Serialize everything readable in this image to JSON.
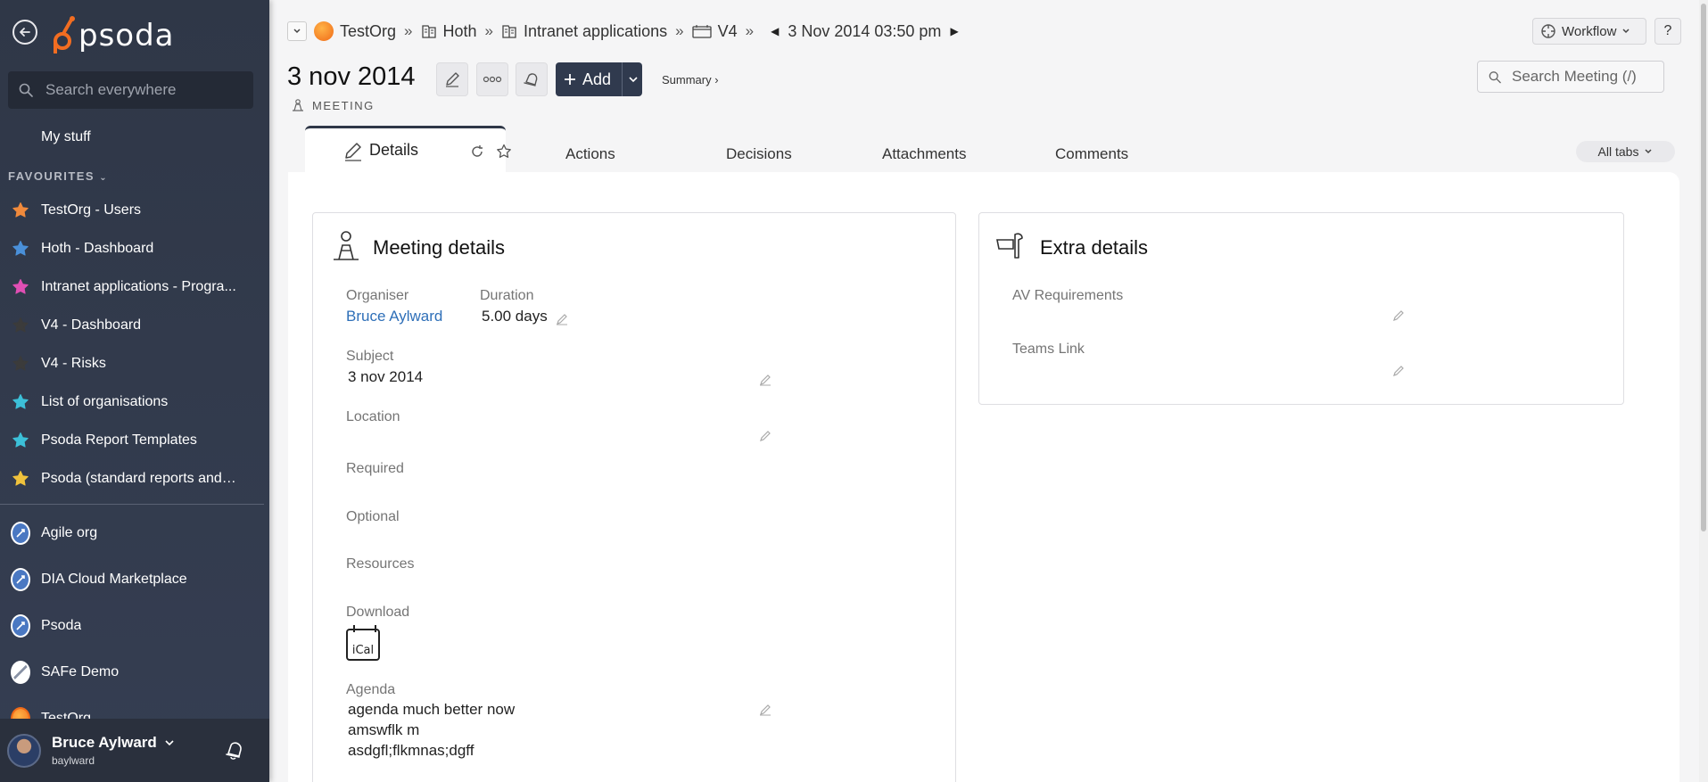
{
  "sidebar": {
    "logo_text": "psoda",
    "search_placeholder": "Search everywhere",
    "my_stuff": "My stuff",
    "favourites_heading": "FAVOURITES",
    "favourites": [
      {
        "label": "TestOrg - Users",
        "color": "#f08a3c"
      },
      {
        "label": "Hoth - Dashboard",
        "color": "#4a90d9"
      },
      {
        "label": "Intranet applications - Progra...",
        "color": "#e04fb4"
      },
      {
        "label": "V4 - Dashboard",
        "color": "#3b3b3b"
      },
      {
        "label": "V4 - Risks",
        "color": "#3b3b3b"
      },
      {
        "label": "List of organisations",
        "color": "#3cc0d8"
      },
      {
        "label": "Psoda Report Templates",
        "color": "#3cc0d8"
      },
      {
        "label": "Psoda (standard reports and ...",
        "color": "#f0c23c"
      }
    ],
    "orgs": [
      "Agile org",
      "DIA Cloud Marketplace",
      "Psoda",
      "SAFe Demo",
      "TestOrg"
    ],
    "user": {
      "name": "Bruce Aylward",
      "handle": "baylward"
    }
  },
  "breadcrumb": {
    "items": [
      "TestOrg",
      "Hoth",
      "Intranet applications",
      "V4"
    ],
    "current": "3 Nov 2014 03:50 pm"
  },
  "header": {
    "workflow_label": "Workflow",
    "help_label": "?",
    "title": "3 nov 2014",
    "add_label": "Add",
    "summary_link": "Summary ›",
    "subtitle": "MEETING",
    "search_placeholder": "Search Meeting (/)"
  },
  "tabs": {
    "active": "Details",
    "items": [
      "Actions",
      "Decisions",
      "Attachments",
      "Comments"
    ],
    "all_tabs": "All tabs"
  },
  "meeting_details": {
    "title": "Meeting details",
    "organiser_label": "Organiser",
    "organiser_value": "Bruce Aylward",
    "duration_label": "Duration",
    "duration_value": "5.00 days",
    "subject_label": "Subject",
    "subject_value": "3 nov 2014",
    "location_label": "Location",
    "required_label": "Required",
    "optional_label": "Optional",
    "resources_label": "Resources",
    "download_label": "Download",
    "ical_label": "iCal",
    "agenda_label": "Agenda",
    "agenda_lines": [
      "agenda much better now",
      "amswflk m",
      "asdgfl;flkmnas;dgff"
    ]
  },
  "extra_details": {
    "title": "Extra details",
    "av_label": "AV Requirements",
    "teams_label": "Teams Link"
  },
  "colors": {
    "sidebar_bg": "#2f3747",
    "add_button": "#303a4e",
    "link": "#2e6fb8"
  }
}
